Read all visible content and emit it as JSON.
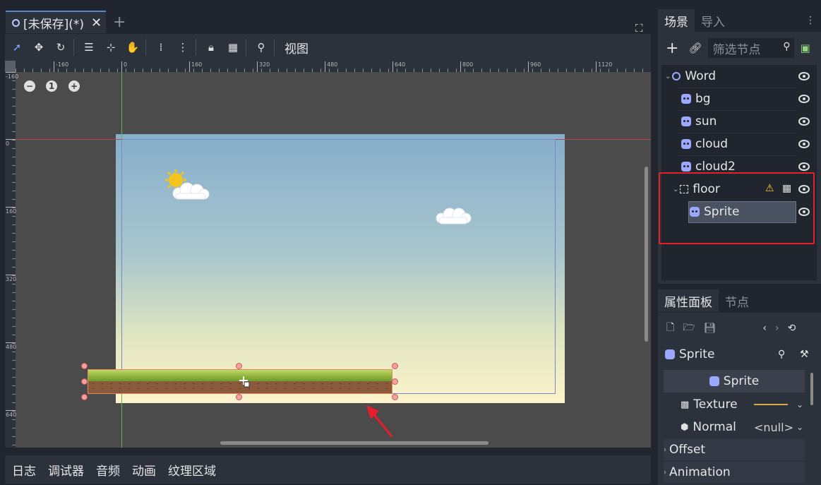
{
  "scene_tab": {
    "title": "[未保存](*)",
    "close": "✕",
    "add": "+"
  },
  "toolbar": {
    "view_menu": "视图"
  },
  "ruler": {
    "h_labels": [
      "-160",
      "0",
      "160",
      "320",
      "480",
      "640",
      "800",
      "960",
      "1120"
    ],
    "v_labels": [
      "-160",
      "0",
      "160",
      "320",
      "480",
      "640"
    ]
  },
  "zoom": {
    "reset": "1"
  },
  "bottom_tabs": [
    "日志",
    "调试器",
    "音频",
    "动画",
    "纹理区域"
  ],
  "scene_dock": {
    "tabs": [
      "场景",
      "导入"
    ],
    "filter_placeholder": "筛选节点",
    "nodes": [
      {
        "name": "Word"
      },
      {
        "name": "bg"
      },
      {
        "name": "sun"
      },
      {
        "name": "cloud"
      },
      {
        "name": "cloud2"
      },
      {
        "name": "floor"
      },
      {
        "name": "Sprite"
      }
    ]
  },
  "inspector": {
    "tabs": [
      "属性面板",
      "节点"
    ],
    "object_name": "Sprite",
    "section": "Sprite",
    "properties": [
      {
        "label": "Texture",
        "value": ""
      },
      {
        "label": "Normal",
        "value": "<null>"
      }
    ],
    "groups": [
      "Offset",
      "Animation"
    ]
  },
  "colors": {
    "accent": "#5d86cf",
    "highlight": "#e81e2a",
    "node_icon": "#9aa8ff"
  }
}
